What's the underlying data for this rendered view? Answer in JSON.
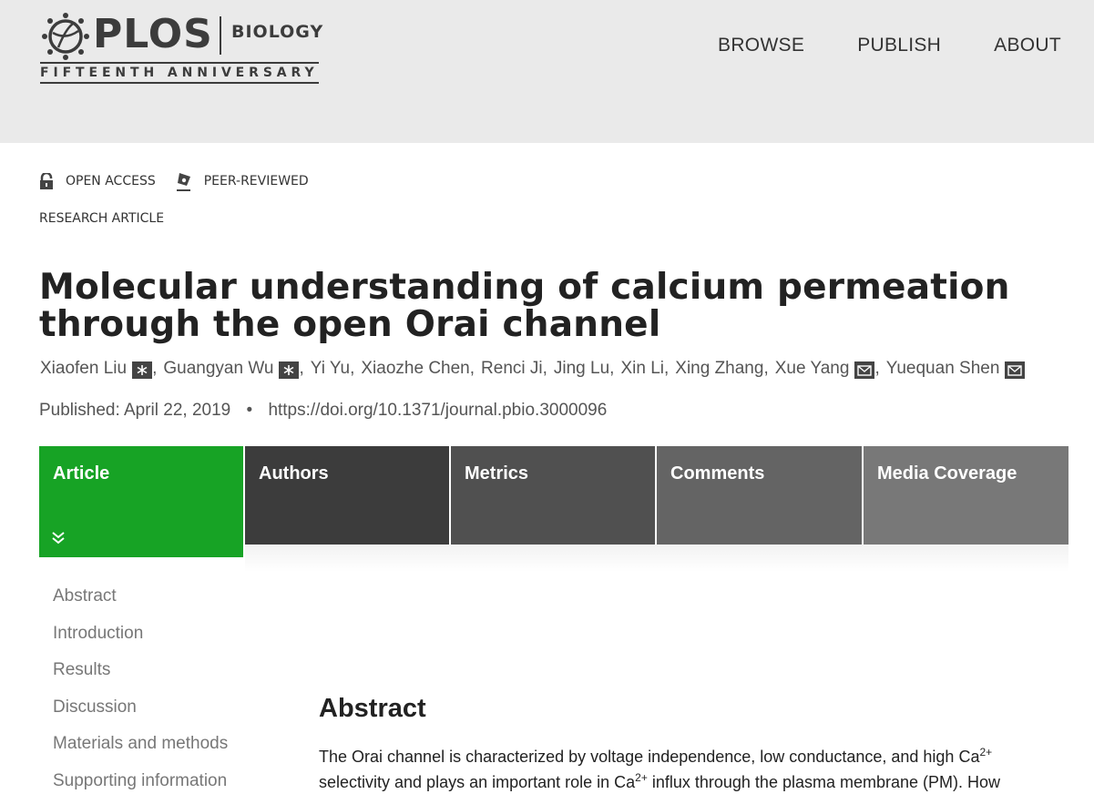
{
  "header": {
    "logo": {
      "brand": "PLOS",
      "journal": "BIOLOGY",
      "tagline": "FIFTEENTH ANNIVERSARY"
    },
    "nav": [
      "BROWSE",
      "PUBLISH",
      "ABOUT"
    ]
  },
  "badges": {
    "open_access": "OPEN ACCESS",
    "peer_reviewed": "PEER-REVIEWED",
    "article_type": "RESEARCH ARTICLE"
  },
  "article": {
    "title": "Molecular understanding of calcium permeation through the open Orai channel",
    "authors": [
      {
        "name": "Xiaofen Liu",
        "icon": "equal-contribution-icon"
      },
      {
        "name": "Guangyan Wu",
        "icon": "equal-contribution-icon"
      },
      {
        "name": "Yi Yu",
        "icon": ""
      },
      {
        "name": "Xiaozhe Chen",
        "icon": ""
      },
      {
        "name": "Renci Ji",
        "icon": ""
      },
      {
        "name": "Jing Lu",
        "icon": ""
      },
      {
        "name": "Xin Li",
        "icon": ""
      },
      {
        "name": "Xing Zhang",
        "icon": ""
      },
      {
        "name": "Xue Yang",
        "icon": "email-icon"
      },
      {
        "name": "Yuequan Shen",
        "icon": "email-icon"
      }
    ],
    "published_label": "Published:",
    "published_date": "April 22, 2019",
    "doi": "https://doi.org/10.1371/journal.pbio.3000096"
  },
  "tabs": [
    {
      "label": "Article",
      "color": "#17a325",
      "active": true
    },
    {
      "label": "Authors",
      "color": "#3c3c3c",
      "active": false
    },
    {
      "label": "Metrics",
      "color": "#505050",
      "active": false
    },
    {
      "label": "Comments",
      "color": "#646464",
      "active": false
    },
    {
      "label": "Media Coverage",
      "color": "#787878",
      "active": false
    }
  ],
  "toc": [
    "Abstract",
    "Introduction",
    "Results",
    "Discussion",
    "Materials and methods",
    "Supporting information"
  ],
  "abstract": {
    "heading": "Abstract",
    "text_line1_a": "The Orai channel is characterized by voltage independence, low conductance, and high Ca",
    "sup1": "2+",
    "text_line2_a": "selectivity and plays an important role in Ca",
    "sup2": "2+",
    "text_line2_b": " influx through the plasma membrane (PM). How"
  },
  "colors": {
    "header_bg": "#eaeaea",
    "accent_green": "#17a325"
  }
}
